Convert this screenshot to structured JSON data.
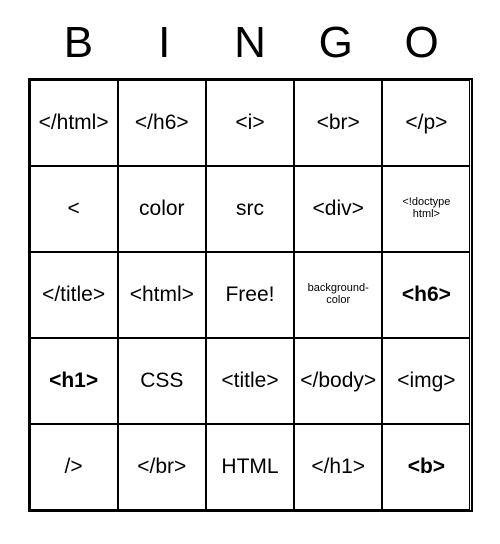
{
  "header": [
    "B",
    "I",
    "N",
    "G",
    "O"
  ],
  "cells": [
    [
      {
        "text": "</html>",
        "size": "normal"
      },
      {
        "text": "</h6>",
        "size": "normal"
      },
      {
        "text": "<i>",
        "size": "normal"
      },
      {
        "text": "<br>",
        "size": "normal"
      },
      {
        "text": "</p>",
        "size": "normal"
      }
    ],
    [
      {
        "text": "<",
        "size": "normal"
      },
      {
        "text": "color",
        "size": "normal"
      },
      {
        "text": "src",
        "size": "normal"
      },
      {
        "text": "<div>",
        "size": "normal"
      },
      {
        "text": "<!doctype html>",
        "size": "xsmall"
      }
    ],
    [
      {
        "text": "</title>",
        "size": "normal"
      },
      {
        "text": "<html>",
        "size": "normal"
      },
      {
        "text": "Free!",
        "size": "normal"
      },
      {
        "text": "background-color",
        "size": "xsmall"
      },
      {
        "text": "<h6>",
        "size": "normal",
        "bold": true
      }
    ],
    [
      {
        "text": "<h1>",
        "size": "normal",
        "bold": true
      },
      {
        "text": "CSS",
        "size": "normal"
      },
      {
        "text": "<title>",
        "size": "normal"
      },
      {
        "text": "</body>",
        "size": "normal"
      },
      {
        "text": "<img>",
        "size": "normal"
      }
    ],
    [
      {
        "text": "/>",
        "size": "normal"
      },
      {
        "text": "</br>",
        "size": "normal"
      },
      {
        "text": "HTML",
        "size": "normal"
      },
      {
        "text": "</h1>",
        "size": "normal"
      },
      {
        "text": "<b>",
        "size": "normal",
        "bold": true
      }
    ]
  ]
}
